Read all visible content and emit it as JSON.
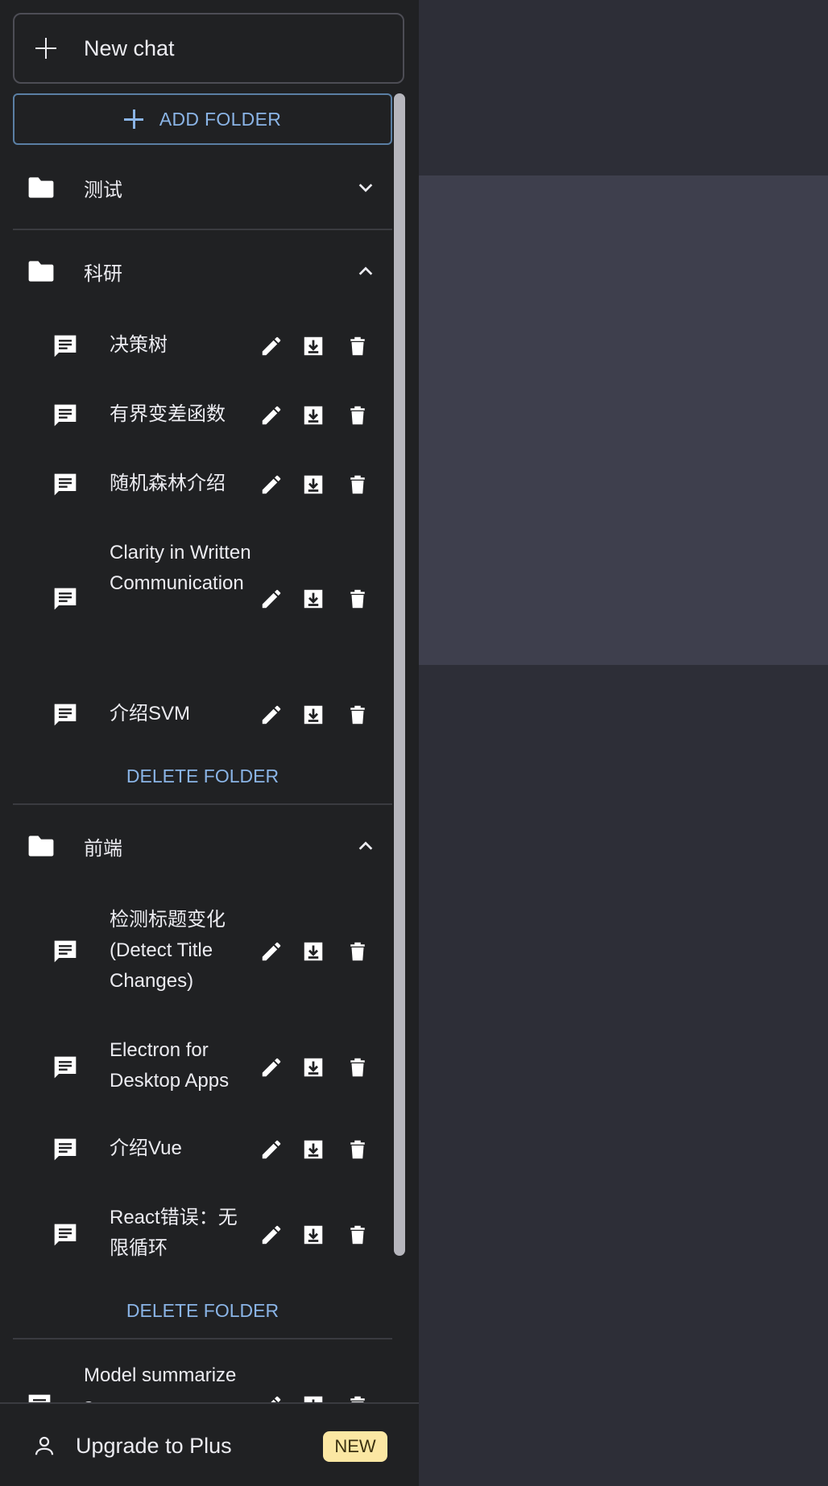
{
  "new_chat": {
    "label": "New chat"
  },
  "add_folder": {
    "label": "ADD FOLDER"
  },
  "folders": [
    {
      "name": "测试",
      "expanded": false
    },
    {
      "name": "科研",
      "expanded": true,
      "chats": [
        "决策树",
        "有界变差函数",
        "随机森林介绍",
        "Clarity in Written Communication",
        "介绍SVM"
      ],
      "delete_label": "DELETE FOLDER"
    },
    {
      "name": "前端",
      "expanded": true,
      "chats": [
        "检测标题变化 (Detect Title Changes)",
        "Electron for Desktop Apps",
        "介绍Vue",
        "React错误：无限循环"
      ],
      "delete_label": "DELETE FOLDER"
    }
  ],
  "ungrouped_chats": [
    "Model summarizes"
  ],
  "footer": {
    "upgrade_label": "Upgrade to Plus",
    "badge": "NEW"
  },
  "colors": {
    "sidebar_bg": "#202123",
    "accent": "#8ab4e6",
    "badge_bg": "#fbe7a3"
  },
  "icons": {
    "folder": "folder-icon",
    "chat": "chat-bubble-icon",
    "edit": "pencil-icon",
    "export": "download-icon",
    "delete": "trash-icon",
    "user": "user-icon"
  }
}
